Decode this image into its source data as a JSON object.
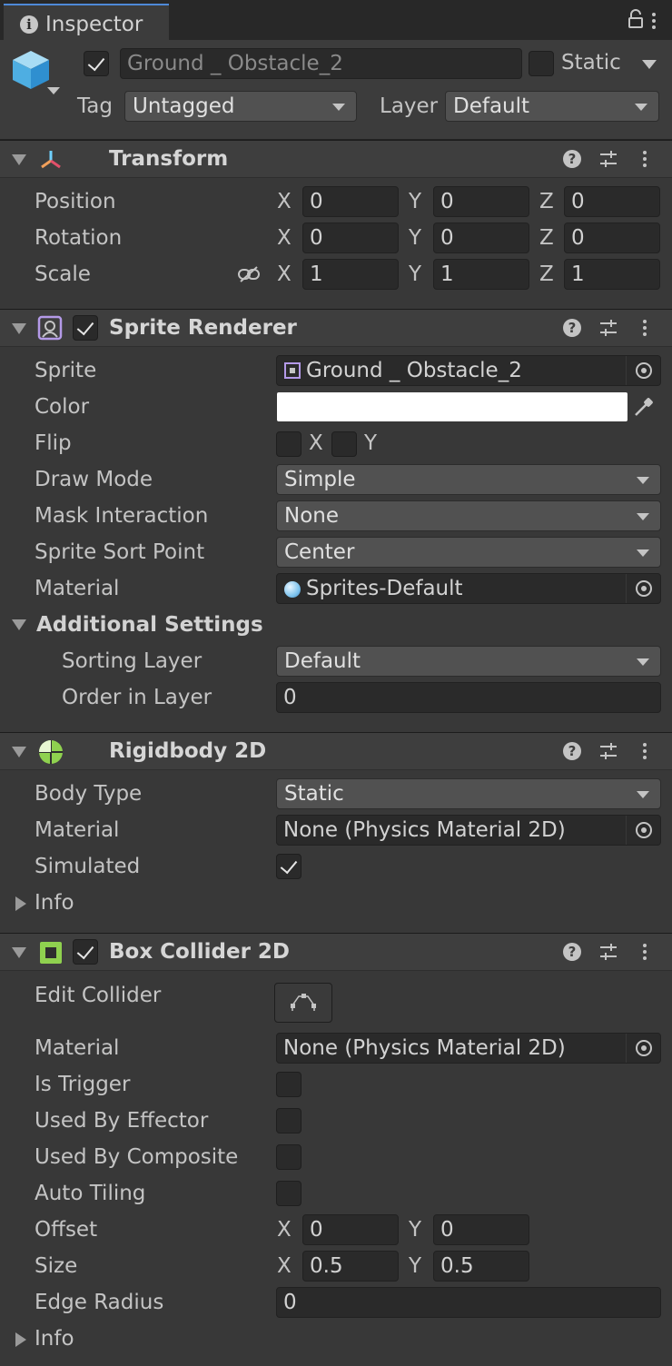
{
  "window": {
    "tab_title": "Inspector"
  },
  "header": {
    "object_name": "Ground _ Obstacle_2",
    "static_label": "Static",
    "tag_label": "Tag",
    "tag_value": "Untagged",
    "layer_label": "Layer",
    "layer_value": "Default"
  },
  "transform": {
    "title": "Transform",
    "rows": [
      {
        "label": "Position",
        "x": "0",
        "y": "0",
        "z": "0"
      },
      {
        "label": "Rotation",
        "x": "0",
        "y": "0",
        "z": "0"
      },
      {
        "label": "Scale",
        "x": "1",
        "y": "1",
        "z": "1"
      }
    ],
    "axis_x": "X",
    "axis_y": "Y",
    "axis_z": "Z"
  },
  "sprite_renderer": {
    "title": "Sprite Renderer",
    "sprite_label": "Sprite",
    "sprite_value": "Ground _ Obstacle_2",
    "color_label": "Color",
    "color_value": "#ffffff",
    "flip_label": "Flip",
    "flip_x": "X",
    "flip_y": "Y",
    "draw_mode_label": "Draw Mode",
    "draw_mode_value": "Simple",
    "mask_label": "Mask Interaction",
    "mask_value": "None",
    "sort_point_label": "Sprite Sort Point",
    "sort_point_value": "Center",
    "material_label": "Material",
    "material_value": "Sprites-Default",
    "additional_label": "Additional Settings",
    "sorting_layer_label": "Sorting Layer",
    "sorting_layer_value": "Default",
    "order_label": "Order in Layer",
    "order_value": "0"
  },
  "rigidbody": {
    "title": "Rigidbody 2D",
    "body_type_label": "Body Type",
    "body_type_value": "Static",
    "material_label": "Material",
    "material_value": "None (Physics Material 2D)",
    "simulated_label": "Simulated",
    "simulated": true,
    "info_label": "Info"
  },
  "box_collider": {
    "title": "Box Collider 2D",
    "edit_label": "Edit Collider",
    "material_label": "Material",
    "material_value": "None (Physics Material 2D)",
    "trigger_label": "Is Trigger",
    "effector_label": "Used By Effector",
    "composite_label": "Used By Composite",
    "tiling_label": "Auto Tiling",
    "offset_label": "Offset",
    "offset_x": "0",
    "offset_y": "0",
    "size_label": "Size",
    "size_x": "0.5",
    "size_y": "0.5",
    "edge_label": "Edge Radius",
    "edge_value": "0",
    "info_label": "Info"
  },
  "colors": {
    "accent": "#4e89d8",
    "rigidbody_icon": "#8fd14f",
    "collider_icon": "#8fd14f"
  }
}
